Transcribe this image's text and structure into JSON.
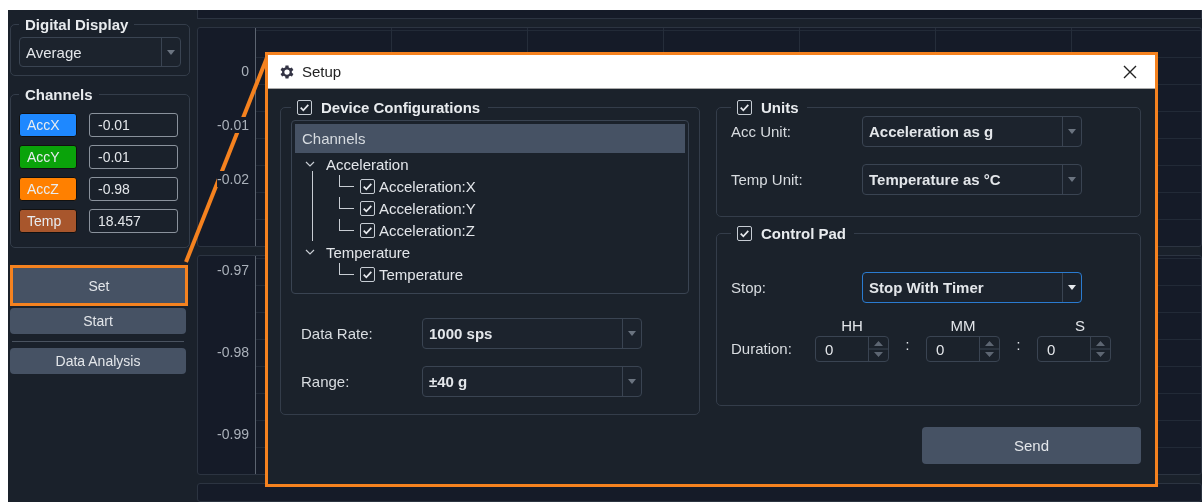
{
  "left_panel": {
    "digital_display": {
      "title": "Digital Display",
      "mode": "Average"
    },
    "channels": {
      "title": "Channels",
      "items": [
        {
          "name": "AccX",
          "color": "#1e88ff",
          "value": "-0.01"
        },
        {
          "name": "AccY",
          "color": "#0aa30a",
          "value": "-0.01"
        },
        {
          "name": "AccZ",
          "color": "#ff8000",
          "value": "-0.98"
        },
        {
          "name": "Temp",
          "color": "#a8562c",
          "value": "18.457"
        }
      ]
    },
    "buttons": [
      {
        "label": "Set",
        "highlighted": true
      },
      {
        "label": "Start",
        "highlighted": false
      }
    ],
    "analysis_button": "Data Analysis"
  },
  "plots": [
    {
      "yticks": [
        "0",
        "-0.01",
        "-0.02"
      ]
    },
    {
      "yticks": [
        "-0.97",
        "-0.98",
        "-0.99"
      ]
    }
  ],
  "dialog": {
    "title": "Setup",
    "device_config": {
      "title": "Device Configurations",
      "checked": true,
      "tree": {
        "header": "Channels",
        "nodes": [
          {
            "label": "Acceleration",
            "expanded": true,
            "children": [
              {
                "label": "Acceleration:X",
                "checked": true
              },
              {
                "label": "Acceleration:Y",
                "checked": true
              },
              {
                "label": "Acceleration:Z",
                "checked": true
              }
            ]
          },
          {
            "label": "Temperature",
            "expanded": true,
            "children": [
              {
                "label": "Temperature",
                "checked": true
              }
            ]
          }
        ]
      },
      "fields": [
        {
          "label": "Data Rate:",
          "value": "1000 sps"
        },
        {
          "label": "Range:",
          "value": "±40 g"
        }
      ]
    },
    "units": {
      "title": "Units",
      "checked": true,
      "fields": [
        {
          "label": "Acc Unit:",
          "value": "Acceleration as g"
        },
        {
          "label": "Temp Unit:",
          "value": "Temperature as °C"
        }
      ]
    },
    "control_pad": {
      "title": "Control Pad",
      "checked": true,
      "stop": {
        "label": "Stop:",
        "value": "Stop With Timer",
        "focused": true
      },
      "duration": {
        "label": "Duration:",
        "separator": ":",
        "parts": [
          {
            "header": "HH",
            "value": "0"
          },
          {
            "header": "MM",
            "value": "0"
          },
          {
            "header": "S",
            "value": "0"
          }
        ]
      }
    },
    "send_button": "Send"
  }
}
